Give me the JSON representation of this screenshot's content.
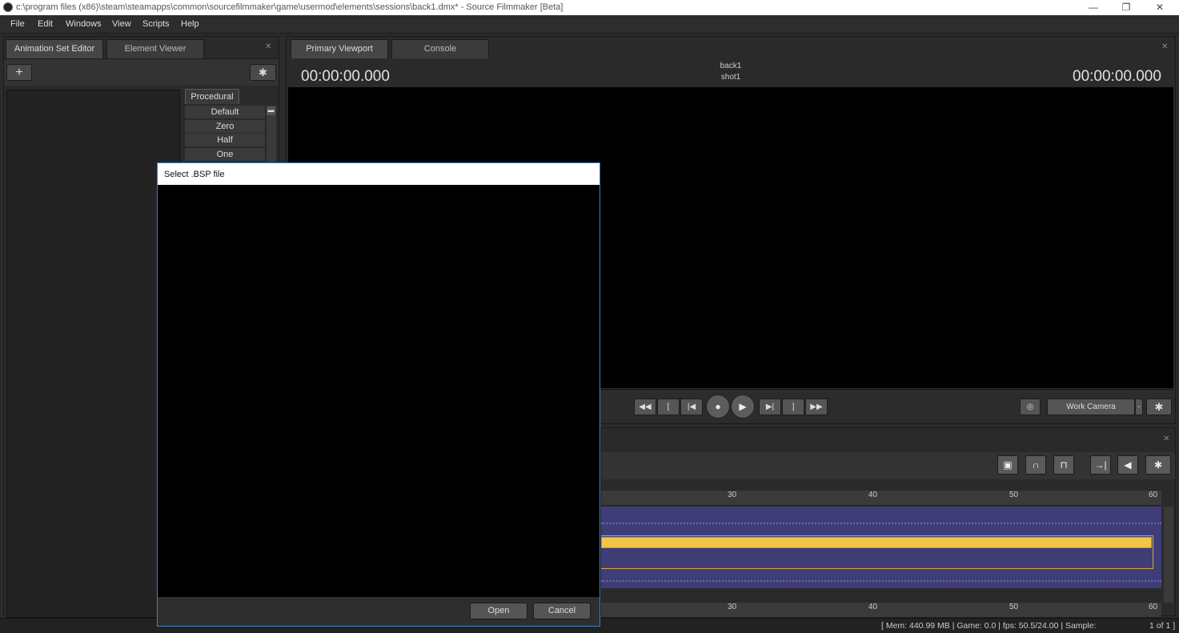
{
  "window": {
    "title": "c:\\program files (x86)\\steam\\steamapps\\common\\sourcefilmmaker\\game\\usermod\\elements\\sessions\\back1.dmx* - Source Filmmaker [Beta]",
    "minimize": "—",
    "restore": "❐",
    "close": "✕"
  },
  "menu": [
    "File",
    "Edit",
    "Windows",
    "View",
    "Scripts",
    "Help"
  ],
  "left_panel": {
    "tabs": [
      "Animation Set Editor",
      "Element Viewer"
    ],
    "close": "✕",
    "add_button": "+",
    "settings_button": "✱",
    "procedural_tab": "Procedural",
    "procedural_items": [
      "Default",
      "Zero",
      "Half",
      "One"
    ]
  },
  "viewport": {
    "tabs": [
      "Primary Viewport",
      "Console"
    ],
    "close": "✕",
    "timecode_left": "00:00:00.000",
    "timecode_right": "00:00:00.000",
    "clip_name": "back1",
    "shot_name": "shot1",
    "camera_select": "Work Camera",
    "dropdown_arrow": "-",
    "settings": "✱"
  },
  "transport": {
    "rewind": "◀◀",
    "mark_in": "[",
    "prev_frame": "|◀",
    "record": "●",
    "play": "▶",
    "next_frame": "▶|",
    "mark_out": "]",
    "fast_forward": "▶▶"
  },
  "timeline": {
    "close": "✕",
    "ruler_ticks": [
      "30",
      "40",
      "50",
      "60"
    ],
    "tools": {
      "lock": "▣",
      "magnet": "∩",
      "magnet_alt": "⊓",
      "jump_end": "→|",
      "volume": "◀",
      "settings": "✱"
    }
  },
  "status": {
    "mem": "[ Mem:  440.99 MB | Game:     0.0 | fps:  50.5/24.00 | Sample:",
    "page": "1 of 1 ]"
  },
  "dialog": {
    "title": "Select .BSP file",
    "open": "Open",
    "cancel": "Cancel"
  },
  "colors": {
    "track": "#3f3d78",
    "clip": "#f1c54a",
    "dialog_border": "#3c7fd1"
  }
}
